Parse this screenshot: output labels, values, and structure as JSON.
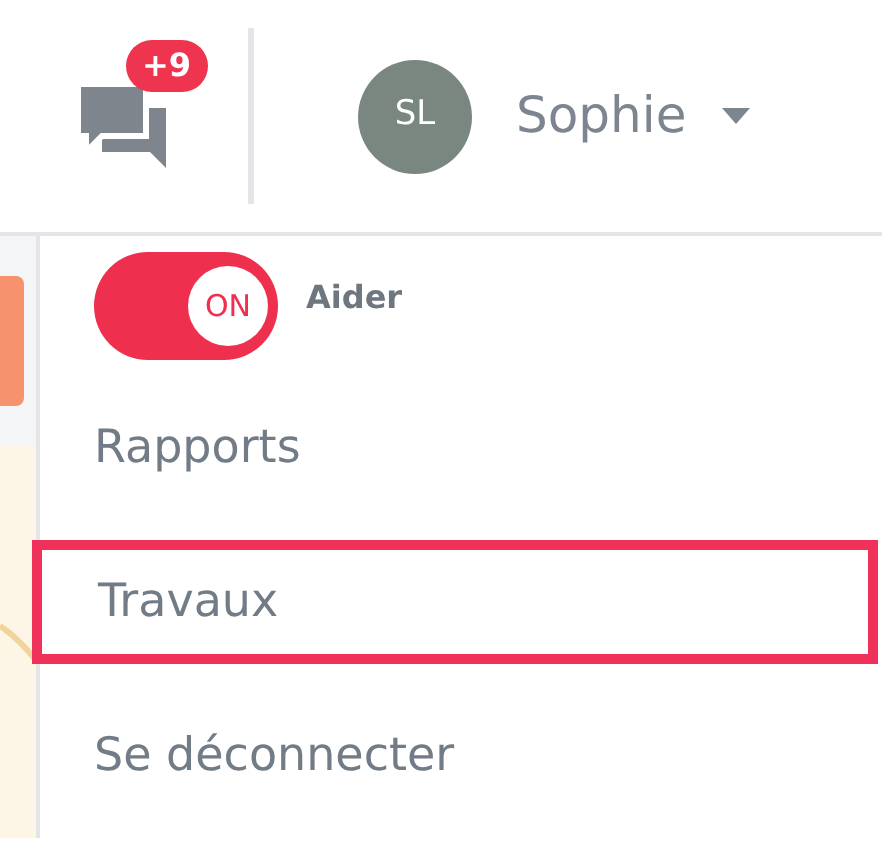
{
  "header": {
    "notifications": {
      "badge": "+9"
    },
    "user": {
      "initials": "SL",
      "name": "Sophie"
    }
  },
  "menu": {
    "expanded": true,
    "items": [
      {
        "kind": "toggle",
        "on": true,
        "toggle_text": "ON",
        "label": "Aider"
      },
      {
        "kind": "link",
        "label": "Rapports",
        "selected": false
      },
      {
        "kind": "link",
        "label": "Travaux",
        "selected": true
      },
      {
        "kind": "link",
        "label": "Se déconnecter",
        "selected": false
      }
    ]
  }
}
